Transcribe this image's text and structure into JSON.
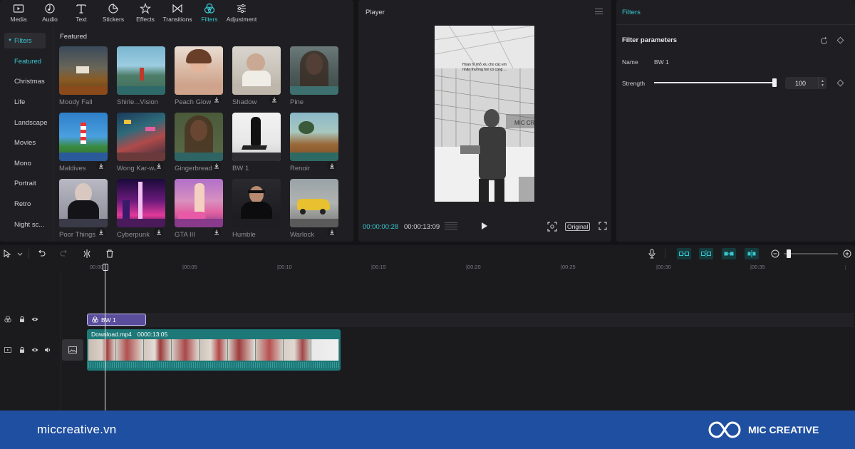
{
  "toolbar": {
    "items": [
      {
        "label": "Media",
        "icon": "media-icon"
      },
      {
        "label": "Audio",
        "icon": "audio-icon"
      },
      {
        "label": "Text",
        "icon": "text-icon"
      },
      {
        "label": "Stickers",
        "icon": "sticker-icon"
      },
      {
        "label": "Effects",
        "icon": "effects-icon"
      },
      {
        "label": "Transitions",
        "icon": "transitions-icon"
      },
      {
        "label": "Filters",
        "icon": "filters-icon",
        "active": true
      },
      {
        "label": "Adjustment",
        "icon": "adjustment-icon"
      }
    ]
  },
  "sidebar": {
    "header": "Filters",
    "items": [
      "Featured",
      "Christmas",
      "Life",
      "Landscape",
      "Movies",
      "Mono",
      "Portrait",
      "Retro",
      "Night sc..."
    ],
    "active": "Featured"
  },
  "grid": {
    "section_title": "Featured",
    "filters": [
      {
        "label": "Moody Fall",
        "download": false
      },
      {
        "label": "Shirle...Vision",
        "download": false
      },
      {
        "label": "Peach Glow",
        "download": true
      },
      {
        "label": "Shadow",
        "download": true
      },
      {
        "label": "Pine",
        "download": false
      },
      {
        "label": "Maldives",
        "download": true
      },
      {
        "label": "Wong Kar-wai",
        "download": true
      },
      {
        "label": "Gingerbread",
        "download": true
      },
      {
        "label": "BW 1",
        "download": false
      },
      {
        "label": "Renoir",
        "download": true
      },
      {
        "label": "Poor Things",
        "download": true
      },
      {
        "label": "Cyberpunk",
        "download": true
      },
      {
        "label": "GTA III",
        "download": true
      },
      {
        "label": "Humble",
        "download": false
      },
      {
        "label": "Warlock",
        "download": true
      }
    ]
  },
  "player": {
    "title": "Player",
    "current_time": "00:00:00:28",
    "total_time": "00:00:13:09",
    "original_label": "Original"
  },
  "properties": {
    "title": "Filters",
    "section": "Filter parameters",
    "name_label": "Name",
    "name_value": "BW 1",
    "strength_label": "Strength",
    "strength_value": "100",
    "strength_fraction": 1.0
  },
  "timeline": {
    "ruler": [
      "00:00",
      "|00:05",
      "|00:10",
      "|00:15",
      "|00:20",
      "|00:25",
      "|00:30",
      "|00:35"
    ],
    "filter_clip_label": "BW 1",
    "video_clip_name": "Download.mp4",
    "video_clip_duration": "0000:13:05"
  },
  "footer": {
    "site": "miccreative.vn",
    "brand": "MIC CREATIVE"
  },
  "colors": {
    "accent": "#38c6cf",
    "filter_clip": "#5a4e9c",
    "video_clip": "#1d7878",
    "footer": "#1f4fa0"
  }
}
